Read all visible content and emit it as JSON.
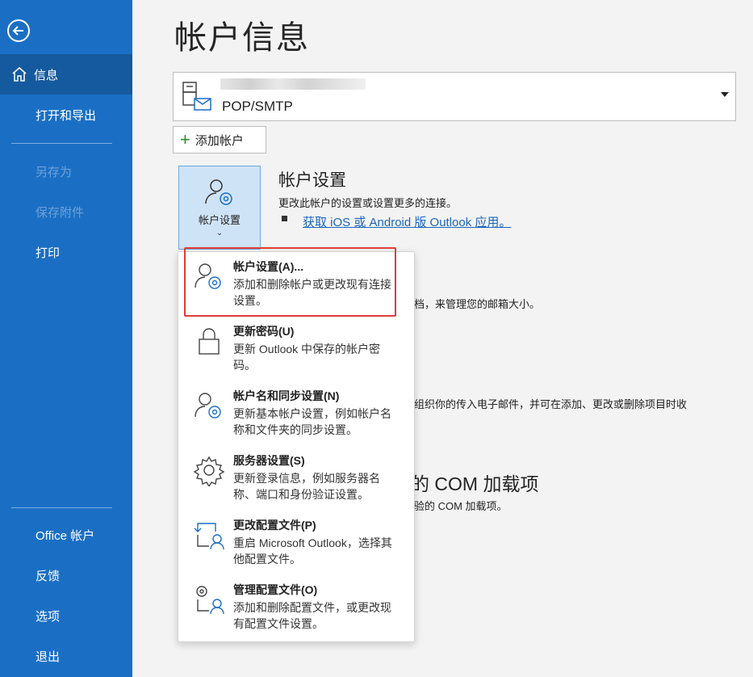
{
  "sidebar": {
    "back_icon": "arrow-left-circle-icon",
    "items": [
      {
        "label": "信息",
        "icon": "home-icon",
        "active": true
      },
      {
        "label": "打开和导出"
      },
      {
        "label": "另存为",
        "disabled": true
      },
      {
        "label": "保存附件",
        "disabled": true
      },
      {
        "label": "打印"
      },
      {
        "label": "Office 帐户"
      },
      {
        "label": "反馈"
      },
      {
        "label": "选项"
      },
      {
        "label": "退出"
      }
    ]
  },
  "main": {
    "title": "帐户信息",
    "account": {
      "type": "POP/SMTP",
      "icon": "mailbox-icon"
    },
    "add_account_label": "添加帐户",
    "settings_button": {
      "label": "帐户设置",
      "icon": "person-gear-icon"
    },
    "settings_section": {
      "title": "帐户设置",
      "desc": "更改此帐户的设置或设置更多的连接。",
      "link": "获取 iOS 或 Android 版 Outlook 应用。"
    },
    "partial_texts": {
      "mailbox": "档，来管理您的邮箱大小。",
      "rules": "组织你的传入电子邮件，并可在添加、更改或删除项目时收",
      "com_title": "的 COM 加载项",
      "com_desc": "验的 COM 加载项。"
    }
  },
  "menu": {
    "items": [
      {
        "title": "帐户设置(A)...",
        "desc": "添加和删除帐户或更改现有连接设置。",
        "icon": "person-gear-icon",
        "highlighted": true
      },
      {
        "title": "更新密码(U)",
        "desc": "更新 Outlook 中保存的帐户密码。",
        "icon": "lock-icon"
      },
      {
        "title": "帐户名和同步设置(N)",
        "desc": "更新基本帐户设置，例如帐户名称和文件夹的同步设置。",
        "icon": "person-gear-icon"
      },
      {
        "title": "服务器设置(S)",
        "desc": "更新登录信息，例如服务器名称、端口和身份验证设置。",
        "icon": "gear-icon"
      },
      {
        "title": "更改配置文件(P)",
        "desc": "重启 Microsoft Outlook，选择其他配置文件。",
        "icon": "profile-switch-icon"
      },
      {
        "title": "管理配置文件(O)",
        "desc": "添加和删除配置文件，或更改现有配置文件设置。",
        "icon": "profile-manage-icon"
      }
    ]
  },
  "colors": {
    "sidebar": "#1a6fc4",
    "sidebar_active": "#155a9e",
    "accent_link": "#1a66b8",
    "highlight": "#e03b3b"
  }
}
